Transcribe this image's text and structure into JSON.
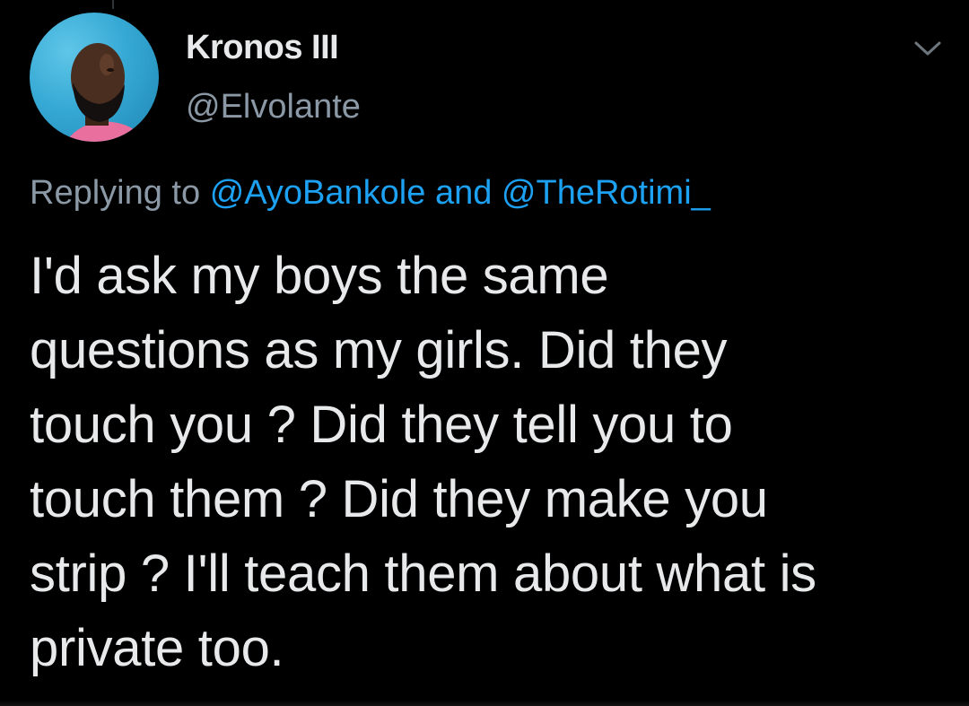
{
  "tweet": {
    "author": {
      "display_name": "Kronos III",
      "handle": "@Elvolante"
    },
    "reply_context": {
      "prefix": "Replying to",
      "mentions": [
        "@AyoBankole",
        "@TheRotimi_"
      ],
      "connector": "and"
    },
    "lines": [
      "I'd ask my boys the same",
      "questions as my girls. Did they",
      "touch you ? Did they tell you to",
      "touch them ? Did they make you",
      "strip ? I'll teach them about what is",
      "private too."
    ]
  },
  "icons": {
    "menu": "chevron-down-icon"
  },
  "colors": {
    "background": "#000000",
    "primary_text": "#e7e9ea",
    "secondary_text": "#8b98a5",
    "link": "#1da1f2"
  }
}
